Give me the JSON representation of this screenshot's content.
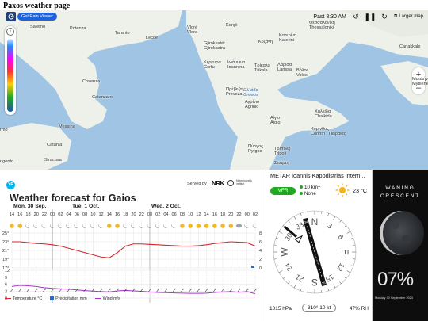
{
  "page_title": "Paxos weather page",
  "map": {
    "radar_label": "Get Rain Viewer",
    "time": "Past 8:30 AM",
    "larger_map": "Larger map",
    "zoom_in": "+",
    "zoom_out": "–",
    "info": "i",
    "places": [
      {
        "name": "Salerno"
      },
      {
        "name": "Potenza"
      },
      {
        "name": "Taranto"
      },
      {
        "name": "Lecce"
      },
      {
        "name": "Vlorë\nVlora"
      },
      {
        "name": "Korçë"
      },
      {
        "name": "Gjirokastër\nGjirokastra"
      },
      {
        "name": "Κερκυρα\nCorfu"
      },
      {
        "name": "Ιωάννινα\nIoannina"
      },
      {
        "name": "Κοζάνη"
      },
      {
        "name": "Κατερίνη\nKaterini"
      },
      {
        "name": "Θεσσαλονίκη\nThessaloniki"
      },
      {
        "name": "Τρίκαλα\nTrikala"
      },
      {
        "name": "Λάρισα\nLarissa"
      },
      {
        "name": "Βόλος\nVolos"
      },
      {
        "name": "Cosenza"
      },
      {
        "name": "Catanzaro"
      },
      {
        "name": "Πρέβεζα\nPreveza"
      },
      {
        "name": "Ελλάδα\nGreece"
      },
      {
        "name": "Αγρίνιο\nAgrinio"
      },
      {
        "name": "Αίγιο\nAigio"
      },
      {
        "name": "Χαλκίδα\nChalkida"
      },
      {
        "name": "Κόρινθος\nCorinth"
      },
      {
        "name": "Πειραιας"
      },
      {
        "name": "Messina"
      },
      {
        "name": "Catania"
      },
      {
        "name": "Siracusa"
      },
      {
        "name": "Πύργος\nPyrgos"
      },
      {
        "name": "Τρίπολη\nTripoli"
      },
      {
        "name": "Σπάρτη"
      },
      {
        "name": "rigento"
      },
      {
        "name": "rmo"
      },
      {
        "name": "Canakkale"
      },
      {
        "name": "Μυτιλήνη\nMytilene"
      }
    ]
  },
  "forecast": {
    "served_by": "Served by",
    "nrk": "NRK",
    "met": "Meteorologisk\ninstitutt",
    "yr": "YR",
    "title": "Weather forecast for Gaios",
    "days": [
      "Mon. 30 Sep.",
      "Tue. 1 Oct.",
      "Wed. 2 Oct."
    ],
    "hours": [
      "14",
      "16",
      "18",
      "20",
      "22",
      "00",
      "02",
      "04",
      "06",
      "08",
      "10",
      "12",
      "14",
      "16",
      "18",
      "20",
      "22",
      "00",
      "02",
      "04",
      "06",
      "08",
      "10",
      "12",
      "14",
      "16",
      "18",
      "20",
      "22",
      "00",
      "02"
    ],
    "y_temp": [
      "25°",
      "23°",
      "21°",
      "19°",
      "17°"
    ],
    "y_precip": [
      "8",
      "6",
      "4",
      "2",
      "0"
    ],
    "y_wind": [
      "12",
      "9",
      "6",
      "3",
      "0"
    ],
    "legend": {
      "temp": "Temperature °C",
      "precip": "Precipitation mm",
      "wind": "Wind m/s"
    },
    "colors": {
      "temp": "#d9262e",
      "precip": "#1f6fd6",
      "wind": "#a236c9"
    }
  },
  "chart_data": {
    "type": "line",
    "x": [
      "14",
      "16",
      "18",
      "20",
      "22",
      "00",
      "02",
      "04",
      "06",
      "08",
      "10",
      "12",
      "14",
      "16",
      "18",
      "20",
      "22",
      "00",
      "02",
      "04",
      "06",
      "08",
      "10",
      "12",
      "14",
      "16",
      "18",
      "20",
      "22",
      "00",
      "02"
    ],
    "series": [
      {
        "name": "Temperature °C",
        "values": [
          23,
          23,
          22.8,
          22.6,
          22.5,
          22.3,
          22,
          21.5,
          21,
          20.5,
          20,
          19.5,
          19.3,
          20.5,
          22,
          22.5,
          22.5,
          22.4,
          22.3,
          22.2,
          22.1,
          22,
          22,
          22.1,
          22.3,
          22.6,
          22.8,
          23,
          22.9,
          22.8,
          22
        ]
      },
      {
        "name": "Wind m/s",
        "values": [
          5,
          5.5,
          5.3,
          5,
          4.5,
          4.2,
          4,
          3.8,
          3.5,
          3.2,
          3,
          2.8,
          2.6,
          3.1,
          3.3,
          3.1,
          2.9,
          2.6,
          2.4,
          2.3,
          2.2,
          2.1,
          2,
          2,
          2.1,
          2.4,
          2.6,
          2.8,
          2.5,
          2.8,
          1.8
        ]
      }
    ],
    "ylim_temp": [
      17,
      25
    ],
    "ylim_wind": [
      0,
      12
    ]
  },
  "metar": {
    "title": "METAR Ioannis Kapodistrias Intern...",
    "flight_rule": "VFR",
    "visibility": "10 km+",
    "clouds": "None",
    "temperature": "23 °C",
    "pressure": "1015 hPa",
    "wind": "310° 10 kt",
    "humidity": "47% RH",
    "compass": [
      "N",
      "3",
      "6",
      "E",
      "12",
      "15",
      "S",
      "21",
      "24",
      "W",
      "30",
      "33"
    ],
    "rwy_top": "34",
    "rwy_bottom": "16"
  },
  "moon": {
    "phase_line1": "WANING",
    "phase_line2": "CRESCENT",
    "percent": "07%",
    "date": "Monday 30 September 2024"
  }
}
